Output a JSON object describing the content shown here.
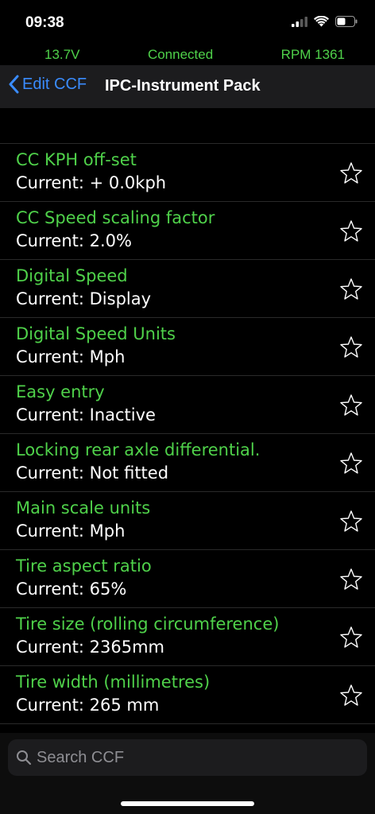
{
  "status": {
    "time": "09:38"
  },
  "info": {
    "voltage": "13.7V",
    "connection": "Connected",
    "rpm": "RPM 1361"
  },
  "nav": {
    "back_label": "Edit CCF",
    "title": "IPC-Instrument Pack"
  },
  "items": [
    {
      "title": "CC KPH off-set",
      "value": "Current: + 0.0kph"
    },
    {
      "title": "CC Speed scaling factor",
      "value": "Current: 2.0%"
    },
    {
      "title": "Digital Speed",
      "value": "Current: Display"
    },
    {
      "title": "Digital Speed Units",
      "value": "Current: Mph"
    },
    {
      "title": "Easy entry",
      "value": "Current: Inactive"
    },
    {
      "title": "Locking rear axle differential.",
      "value": "Current: Not fitted"
    },
    {
      "title": "Main scale units",
      "value": "Current: Mph"
    },
    {
      "title": "Tire aspect ratio",
      "value": "Current: 65%"
    },
    {
      "title": "Tire size (rolling circumference)",
      "value": "Current: 2365mm"
    },
    {
      "title": "Tire width (millimetres)",
      "value": "Current: 265 mm"
    }
  ],
  "search": {
    "placeholder": "Search CCF"
  },
  "colors": {
    "accent_green": "#4fd14a",
    "link_blue": "#3a8cff",
    "background": "#000000"
  }
}
